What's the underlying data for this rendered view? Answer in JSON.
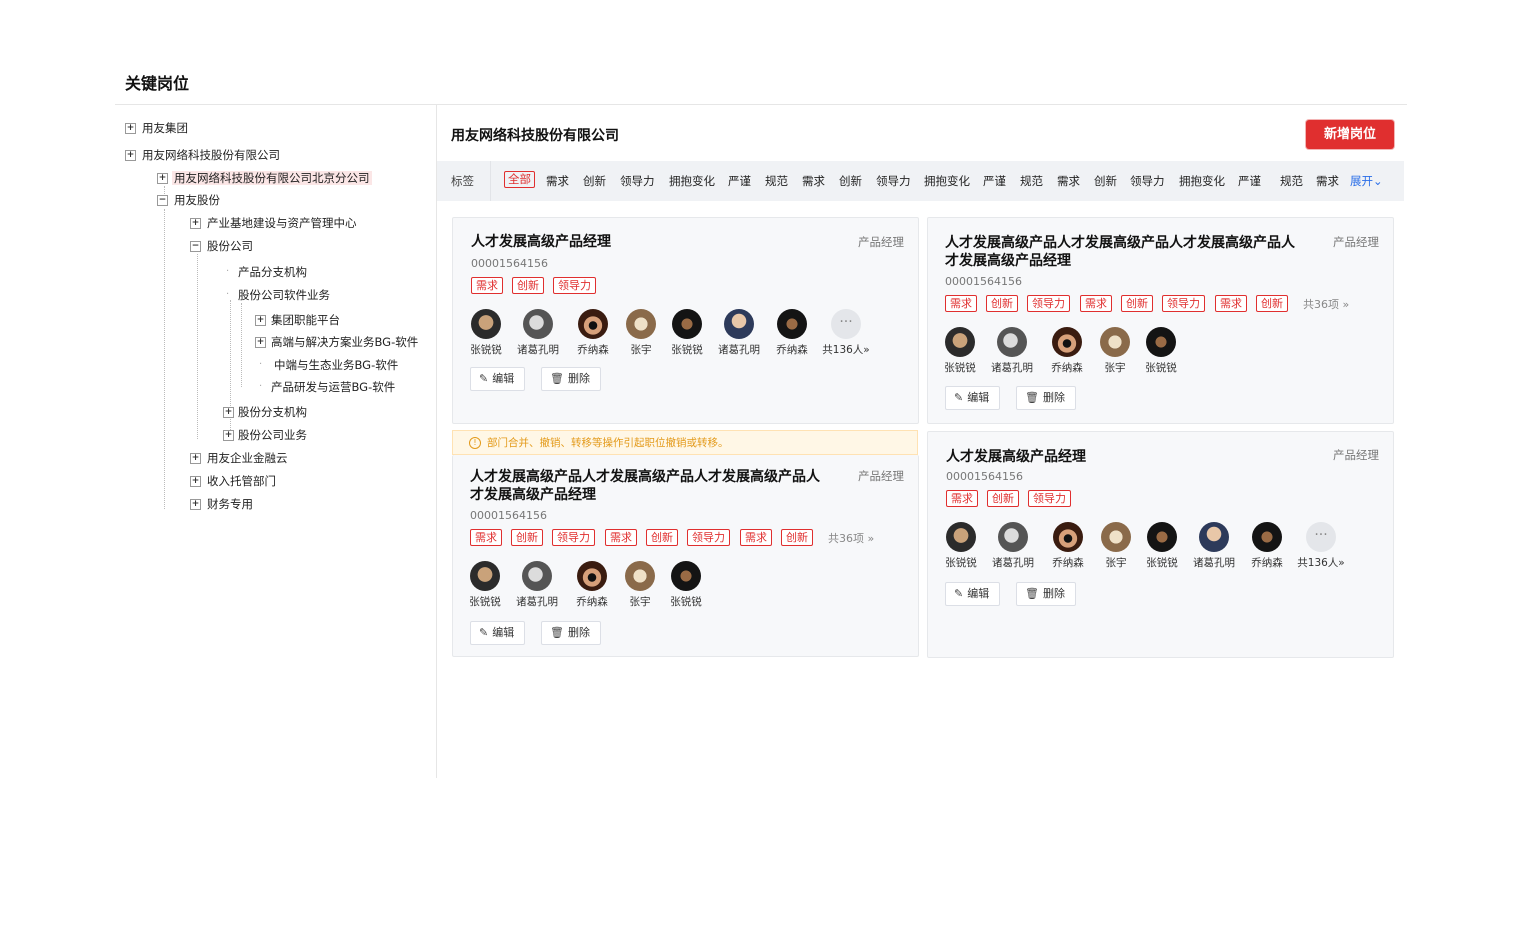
{
  "page": {
    "title": "关键岗位"
  },
  "tree": [
    {
      "label": "用友集团",
      "toggle": "+"
    },
    {
      "label": "用友网络科技股份有限公司",
      "toggle": "+"
    },
    {
      "label": "用友网络科技股份有限公司北京分公司",
      "toggle": "+"
    },
    {
      "label": "用友股份",
      "toggle": "−"
    },
    {
      "label": "产业基地建设与资产管理中心",
      "toggle": "+"
    },
    {
      "label": "股份公司",
      "toggle": "−"
    },
    {
      "label": "产品分支机构",
      "toggle": ""
    },
    {
      "label": "股份公司软件业务",
      "toggle": ""
    },
    {
      "label": "集团职能平台",
      "toggle": "+"
    },
    {
      "label": "高端与解决方案业务BG-软件",
      "toggle": "+"
    },
    {
      "label": "中端与生态业务BG-软件",
      "toggle": ""
    },
    {
      "label": "产品研发与运营BG-软件",
      "toggle": ""
    },
    {
      "label": "股份分支机构",
      "toggle": "+"
    },
    {
      "label": "股份公司业务",
      "toggle": "+"
    },
    {
      "label": "用友企业金融云",
      "toggle": "+"
    },
    {
      "label": "收入托管部门",
      "toggle": "+"
    },
    {
      "label": "财务专用",
      "toggle": "+"
    }
  ],
  "main": {
    "company": "用友网络科技股份有限公司",
    "add_button": "新增岗位",
    "tagbar_label": "标签",
    "filter_tags": [
      "全部",
      "需求",
      "创新",
      "领导力",
      "拥抱变化",
      "严谨",
      "规范",
      "需求",
      "创新",
      "领导力",
      "拥抱变化",
      "严谨",
      "规范",
      "需求",
      "创新",
      "领导力",
      "拥抱变化",
      "严谨",
      "规范",
      "需求"
    ],
    "expand": "展开⌄",
    "warning": "部门合并、撤销、转移等操作引起职位撤销或转移。",
    "warning_icon": "!",
    "more_icon": "···",
    "edit_icon": "✎",
    "delete_icon": "🗑"
  },
  "cards": [
    {
      "title": "人才发展高级产品经理",
      "type": "产品经理",
      "code": "00001564156",
      "tags": [
        "需求",
        "创新",
        "领导力"
      ],
      "tags_more": "",
      "people": [
        "张锐锐",
        "诸葛孔明",
        "乔纳森",
        "张宇",
        "张锐锐",
        "诸葛孔明",
        "乔纳森"
      ],
      "people_more": "共136人»",
      "edit": "编辑",
      "delete": "删除"
    },
    {
      "title": "人才发展高级产品人才发展高级产品人才发展高级产品人才发展高级产品经理",
      "type": "产品经理",
      "code": "00001564156",
      "tags": [
        "需求",
        "创新",
        "领导力",
        "需求",
        "创新",
        "领导力",
        "需求",
        "创新"
      ],
      "tags_more": "共36项 »",
      "people": [
        "张锐锐",
        "诸葛孔明",
        "乔纳森",
        "张宇",
        "张锐锐"
      ],
      "people_more": "",
      "edit": "编辑",
      "delete": "删除"
    },
    {
      "title": "人才发展高级产品人才发展高级产品人才发展高级产品人才发展高级产品经理",
      "type": "产品经理",
      "code": "00001564156",
      "tags": [
        "需求",
        "创新",
        "领导力",
        "需求",
        "创新",
        "领导力",
        "需求",
        "创新"
      ],
      "tags_more": "共36项 »",
      "people": [
        "张锐锐",
        "诸葛孔明",
        "乔纳森",
        "张宇",
        "张锐锐"
      ],
      "people_more": "",
      "edit": "编辑",
      "delete": "删除"
    },
    {
      "title": "人才发展高级产品经理",
      "type": "产品经理",
      "code": "00001564156",
      "tags": [
        "需求",
        "创新",
        "领导力"
      ],
      "tags_more": "",
      "people": [
        "张锐锐",
        "诸葛孔明",
        "乔纳森",
        "张宇",
        "张锐锐",
        "诸葛孔明",
        "乔纳森"
      ],
      "people_more": "共136人»",
      "edit": "编辑",
      "delete": "删除"
    }
  ]
}
